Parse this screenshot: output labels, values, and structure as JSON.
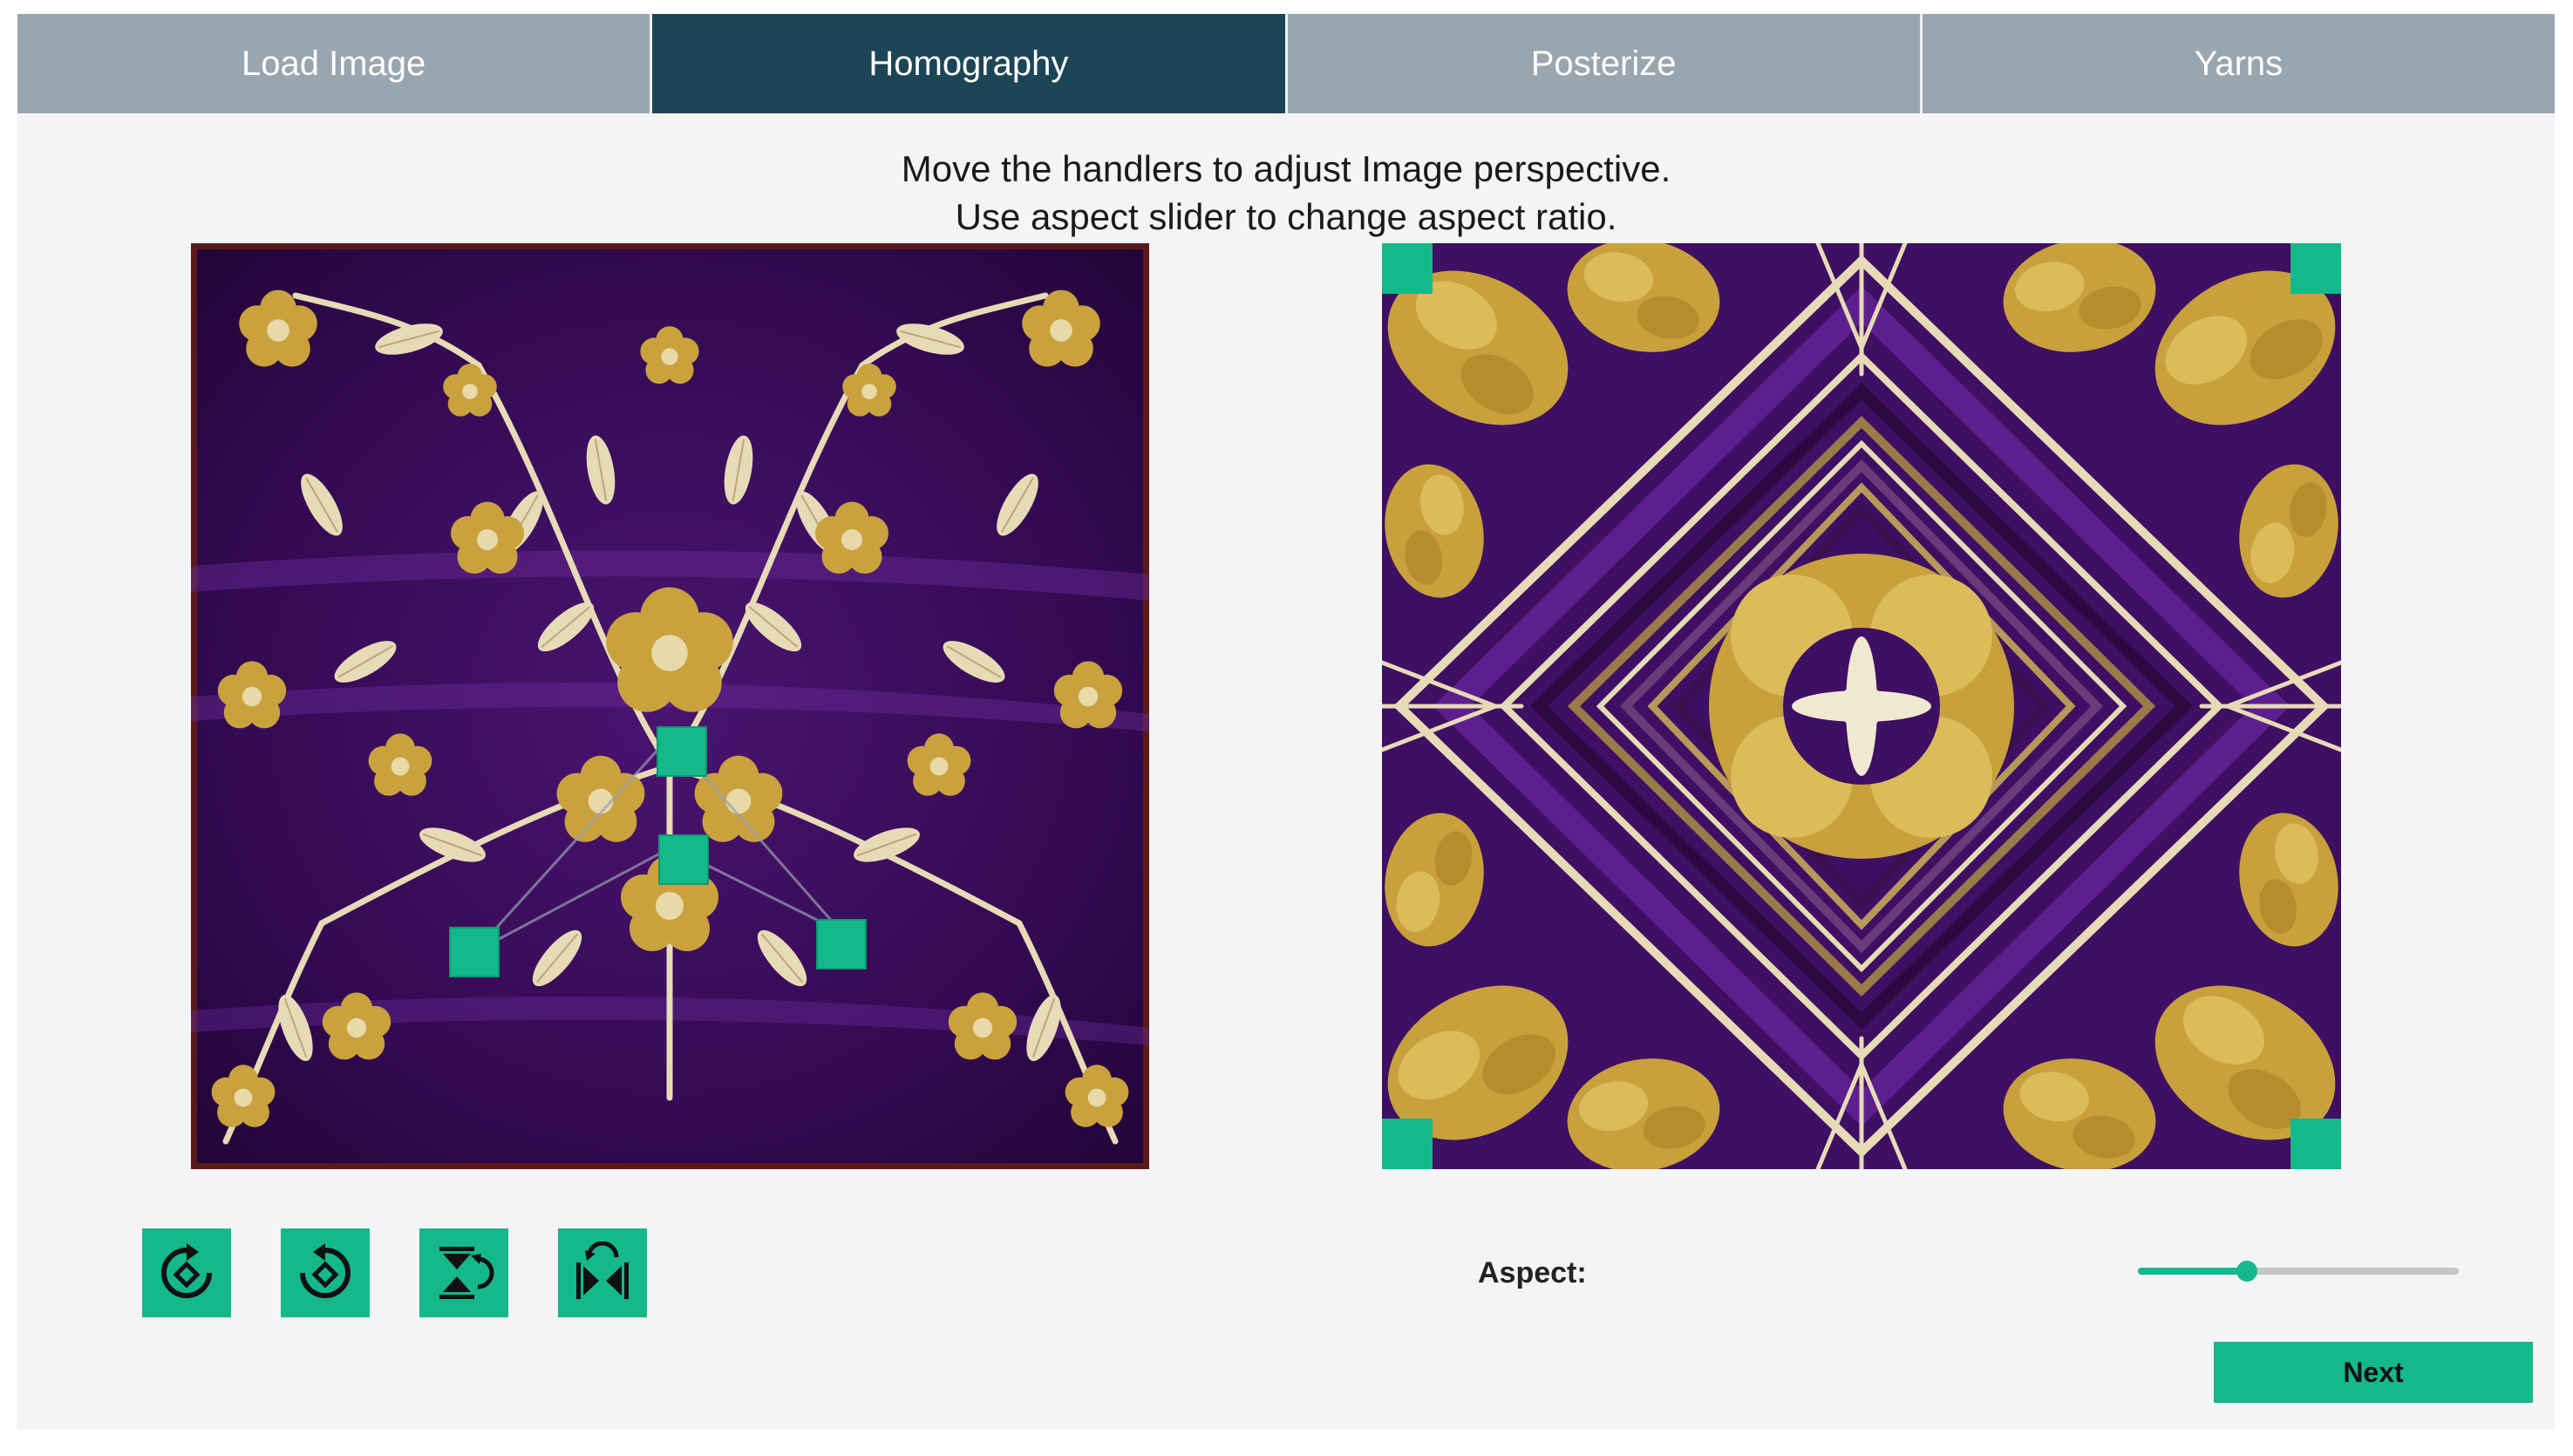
{
  "tabs": [
    {
      "label": "Load Image",
      "active": false
    },
    {
      "label": "Homography",
      "active": true
    },
    {
      "label": "Posterize",
      "active": false
    },
    {
      "label": "Yarns",
      "active": false
    }
  ],
  "instructions": {
    "line1": "Move the handlers to adjust Image perspective.",
    "line2": "Use aspect slider to change aspect ratio."
  },
  "toolbar": [
    {
      "name": "rotate-left-icon"
    },
    {
      "name": "rotate-right-icon"
    },
    {
      "name": "flip-vertical-icon"
    },
    {
      "name": "flip-horizontal-icon"
    }
  ],
  "aspect": {
    "label": "Aspect:",
    "value_fraction": 0.34
  },
  "next_button": {
    "label": "Next"
  },
  "colors": {
    "accent": "#14b88a",
    "tab_active": "#1c4556",
    "tab_inactive": "#9aa6af",
    "fabric_purple": "#3c0d5c",
    "fabric_gold": "#c8a03c",
    "fabric_cream": "#e8ddb8"
  }
}
